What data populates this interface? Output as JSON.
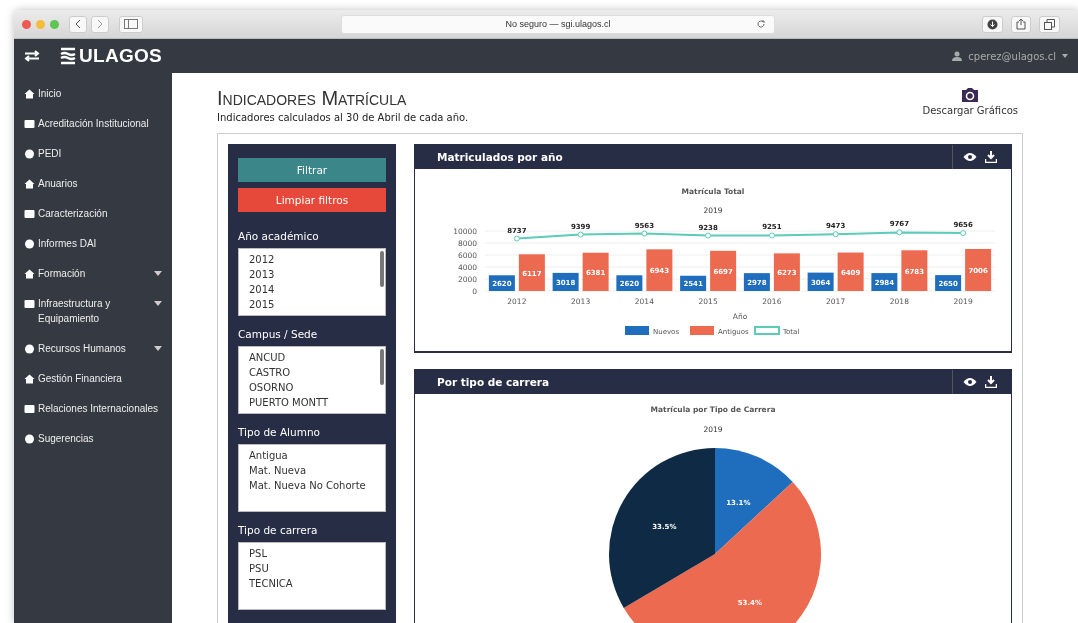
{
  "browser": {
    "address": "No seguro — sgi.ulagos.cl"
  },
  "header": {
    "logo": "ULAGOS",
    "user": "cperez@ulagos.cl"
  },
  "sidebar": {
    "items": [
      {
        "label": "Inicio",
        "dropdown": false
      },
      {
        "label": "Acreditación Institucional",
        "dropdown": false
      },
      {
        "label": "PEDI",
        "dropdown": false
      },
      {
        "label": "Anuarios",
        "dropdown": false
      },
      {
        "label": "Caracterización",
        "dropdown": false
      },
      {
        "label": "Informes DAI",
        "dropdown": false
      },
      {
        "label": "Formación",
        "dropdown": true
      },
      {
        "label": "Infraestructura y Equipamiento",
        "dropdown": true
      },
      {
        "label": "Recursos Humanos",
        "dropdown": true
      },
      {
        "label": "Gestión Financiera",
        "dropdown": false
      },
      {
        "label": "Relaciones Internacionales",
        "dropdown": false
      },
      {
        "label": "Sugerencias",
        "dropdown": false
      }
    ]
  },
  "page": {
    "title": "Indicadores Matrícula",
    "subtitle": "Indicadores calculados al 30 de Abril de cada año.",
    "download": "Descargar Gráficos"
  },
  "filters": {
    "buttons": [
      {
        "label": "Filtrar",
        "kind": "primary"
      },
      {
        "label": "Limpiar filtros",
        "kind": "danger"
      }
    ],
    "groups": [
      {
        "label": "Año académico",
        "options": [
          "2012",
          "2013",
          "2014",
          "2015"
        ],
        "scrollbar": true
      },
      {
        "label": "Campus / Sede",
        "options": [
          "ANCUD",
          "CASTRO",
          "OSORNO",
          "PUERTO MONTT"
        ],
        "scrollbar": true
      },
      {
        "label": "Tipo de Alumno",
        "options": [
          "Antigua",
          "Mat. Nueva",
          "Mat. Nueva No Cohorte"
        ],
        "scrollbar": false
      },
      {
        "label": "Tipo de carrera",
        "options": [
          "PSL",
          "PSU",
          "TECNICA"
        ],
        "scrollbar": false
      }
    ]
  },
  "panels": [
    {
      "title": "Matriculados por año",
      "chart_data": {
        "type": "bar",
        "title": "Matrícula Total",
        "subtitle": "2019",
        "xlabel": "Año",
        "categories": [
          "2012",
          "2013",
          "2014",
          "2015",
          "2016",
          "2017",
          "2018",
          "2019"
        ],
        "ylim": [
          0,
          10000
        ],
        "stacked": false,
        "grid": true,
        "legend": "bottom",
        "yticks": [
          0,
          2000,
          4000,
          6000,
          8000,
          10000
        ],
        "data_labels": true,
        "series": [
          {
            "name": "Nuevos",
            "color": "#1f6dbd",
            "type": "bar",
            "values": [
              2620,
              3018,
              2620,
              2541,
              2978,
              3064,
              2984,
              2650
            ]
          },
          {
            "name": "Antiguos",
            "color": "#ec6a4f",
            "type": "bar",
            "values": [
              6117,
              6381,
              6943,
              6697,
              6273,
              6409,
              6783,
              7006
            ]
          },
          {
            "name": "Total",
            "color": "#5ccbb8",
            "type": "line",
            "marker": true,
            "values": [
              8737,
              9399,
              9563,
              9238,
              9251,
              9473,
              9767,
              9656
            ]
          }
        ]
      }
    },
    {
      "title": "Por tipo de carrera",
      "chart_data": {
        "type": "pie",
        "title": "Matrícula por Tipo de Carrera",
        "subtitle": "2019",
        "value_labels": [
          "13.1%",
          "53.4%",
          "33.5%"
        ],
        "series": [
          {
            "values": [
              13.1,
              53.4,
              33.5
            ]
          }
        ],
        "colors": [
          "#1f6dbd",
          "#ec6a4f",
          "#0e2a45"
        ]
      }
    }
  ]
}
